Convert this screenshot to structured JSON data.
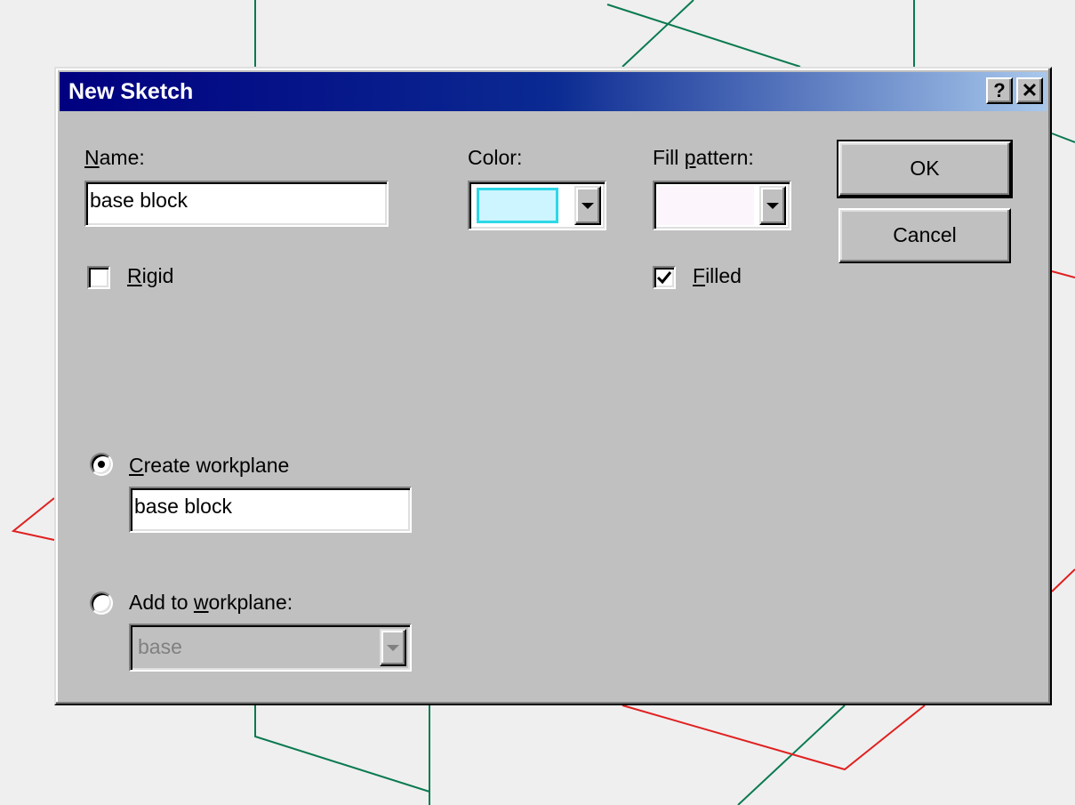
{
  "dialog": {
    "title": "New Sketch",
    "help_button": "?",
    "close_button": "✕"
  },
  "name": {
    "label_mnemonic": "N",
    "label_rest": "ame:",
    "value": "base block"
  },
  "color": {
    "label": "Color:",
    "selected_color": "#ccf5ff"
  },
  "fill_pattern": {
    "label_before": "Fill ",
    "label_mnemonic": "p",
    "label_after": "attern:",
    "selected_color": "#fcf5fc"
  },
  "rigid": {
    "label_mnemonic": "R",
    "label_rest": "igid",
    "checked": false
  },
  "filled": {
    "label_mnemonic": "F",
    "label_rest": "illed",
    "checked": true
  },
  "buttons": {
    "ok": "OK",
    "cancel": "Cancel"
  },
  "create_workplane": {
    "label_mnemonic": "C",
    "label_rest": "reate workplane",
    "selected": true,
    "value": "base block"
  },
  "add_to_workplane": {
    "label_before": "Add to ",
    "label_mnemonic": "w",
    "label_after": "orkplane:",
    "selected": false,
    "value": "base"
  },
  "colors": {
    "accent": "#000080",
    "face": "#c0c0c0",
    "sketch_green": "#0a7a50",
    "sketch_red": "#e02020"
  },
  "icons": {
    "help": "question-mark-icon",
    "close": "close-icon",
    "check": "checkmark-icon",
    "dropdown": "chevron-down-icon"
  }
}
